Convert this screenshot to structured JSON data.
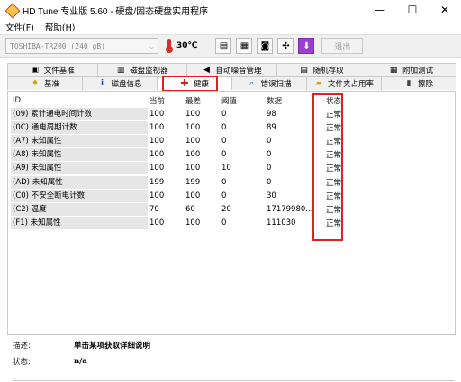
{
  "window": {
    "title": "HD Tune 专业版 5.60 - 硬盘/固态硬盘实用程序",
    "controls": [
      "—",
      "☐",
      "✕"
    ]
  },
  "menu": [
    {
      "label": "文件(F)"
    },
    {
      "label": "帮助(H)"
    }
  ],
  "toolbar": {
    "drive": "TOSHIBA-TR200 (240 gB)",
    "temperature": "30℃",
    "buttons": [
      {
        "icon": "copy-info-icon",
        "glyph": "▤"
      },
      {
        "icon": "copy-text-icon",
        "glyph": "▦"
      },
      {
        "icon": "camera-icon",
        "glyph": "◙"
      },
      {
        "icon": "options-icon",
        "glyph": "✣"
      },
      {
        "icon": "save-icon",
        "glyph": "⬇"
      }
    ],
    "exit_label": "退出"
  },
  "tabs": {
    "row1": [
      {
        "label": "文件基准",
        "icon": "file-benchmark-icon",
        "glyph": "▣"
      },
      {
        "label": "磁盘监视器",
        "icon": "disk-monitor-icon",
        "glyph": "▥"
      },
      {
        "label": "自动噪音管理",
        "icon": "speaker-icon",
        "glyph": "◀"
      },
      {
        "label": "随机存取",
        "icon": "random-access-icon",
        "glyph": "▤"
      },
      {
        "label": "附加测试",
        "icon": "extra-tests-icon",
        "glyph": "▦"
      }
    ],
    "row2": [
      {
        "label": "基准",
        "icon": "benchmark-icon",
        "glyph": "♦"
      },
      {
        "label": "磁盘信息",
        "icon": "info-icon",
        "glyph": "i"
      },
      {
        "label": "健康",
        "icon": "health-cross-icon",
        "glyph": "✚"
      },
      {
        "label": "错误扫描",
        "icon": "error-scan-icon",
        "glyph": "⌕"
      },
      {
        "label": "文件夹占用率",
        "icon": "folder-usage-icon",
        "glyph": "▰"
      },
      {
        "label": "擦除",
        "icon": "erase-icon",
        "glyph": "▮"
      }
    ],
    "active": "健康"
  },
  "table": {
    "headers": [
      "ID",
      "当前",
      "最差",
      "阈值",
      "数据",
      "状态"
    ],
    "rows": [
      {
        "id": "(09) 累计通电时间计数",
        "cur": "100",
        "worst": "100",
        "thr": "0",
        "data": "98",
        "status": "正常"
      },
      {
        "id": "(0C) 通电周期计数",
        "cur": "100",
        "worst": "100",
        "thr": "0",
        "data": "89",
        "status": "正常"
      },
      {
        "id": "(A7) 未知属性",
        "cur": "100",
        "worst": "100",
        "thr": "0",
        "data": "0",
        "status": "正常"
      },
      {
        "id": "(A8) 未知属性",
        "cur": "100",
        "worst": "100",
        "thr": "0",
        "data": "0",
        "status": "正常"
      },
      {
        "id": "(A9) 未知属性",
        "cur": "100",
        "worst": "100",
        "thr": "10",
        "data": "0",
        "status": "正常"
      },
      {
        "id": "(AD) 未知属性",
        "cur": "199",
        "worst": "199",
        "thr": "0",
        "data": "0",
        "status": "正常"
      },
      {
        "id": "(C0) 不安全断电计数",
        "cur": "100",
        "worst": "100",
        "thr": "0",
        "data": "30",
        "status": "正常"
      },
      {
        "id": "(C2) 温度",
        "cur": "70",
        "worst": "60",
        "thr": "20",
        "data": "17179980...",
        "status": "正常"
      },
      {
        "id": "(F1) 未知属性",
        "cur": "100",
        "worst": "100",
        "thr": "0",
        "data": "111030",
        "status": "正常"
      }
    ]
  },
  "footer": {
    "desc_label": "描述:",
    "desc_value": "单击某项获取详细说明",
    "status_label": "状态:",
    "status_value": "n/a"
  }
}
